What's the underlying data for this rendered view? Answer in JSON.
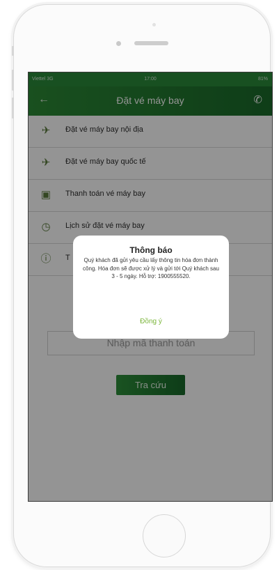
{
  "status_bar": {
    "carrier": "Viettel 3G",
    "time": "17:00",
    "battery": "81%"
  },
  "header": {
    "title": "Đặt vé máy bay",
    "back_icon": "back-arrow-icon",
    "phone_icon": "phone-icon"
  },
  "menu": {
    "items": [
      {
        "label": "Đặt vé máy bay nội địa",
        "icon": "plane-domestic-icon"
      },
      {
        "label": "Đặt vé máy bay quốc tế",
        "icon": "plane-international-icon"
      },
      {
        "label": "Thanh toán vé máy bay",
        "icon": "card-icon"
      },
      {
        "label": "Lịch sử đặt vé máy bay",
        "icon": "history-icon"
      },
      {
        "label": "T",
        "icon": "info-icon"
      }
    ]
  },
  "form": {
    "input_placeholder": "Nhập mã thanh toán",
    "search_label": "Tra cứu"
  },
  "dialog": {
    "title": "Thông báo",
    "message": "Quý khách đã gửi yêu cầu lấy thông tin hóa đơn thành công. Hóa đơn sẽ được xử lý và gửi tới Quý khách sau 3 - 5 ngày. Hỗ trợ: 1900555520.",
    "confirm_label": "Đồng ý"
  },
  "colors": {
    "brand_green": "#2c8a36",
    "dialog_button": "#7ab53a"
  }
}
